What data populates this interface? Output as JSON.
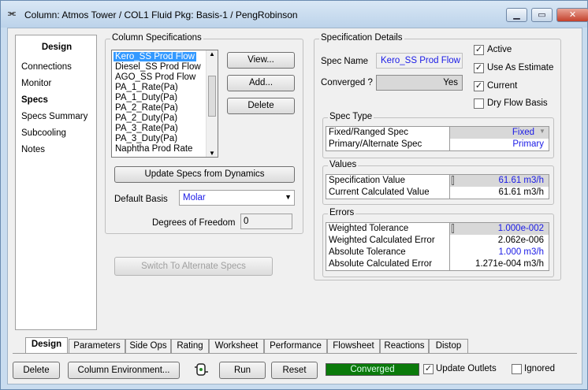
{
  "window": {
    "title": "Column: Atmos Tower / COL1  Fluid Pkg: Basis-1 / PengRobinson",
    "minimize_icon": "minimize-icon",
    "maximize_icon": "maximize-icon",
    "close_icon": "close-icon"
  },
  "nav": {
    "header": "Design",
    "items": [
      "Connections",
      "Monitor",
      "Specs",
      "Specs Summary",
      "Subcooling",
      "Notes"
    ],
    "selected": "Specs"
  },
  "column_specs": {
    "label": "Column Specifications",
    "list": [
      "Kero_SS Prod Flow",
      "Diesel_SS Prod Flow",
      "AGO_SS Prod Flow",
      "PA_1_Rate(Pa)",
      "PA_1_Duty(Pa)",
      "PA_2_Rate(Pa)",
      "PA_2_Duty(Pa)",
      "PA_3_Rate(Pa)",
      "PA_3_Duty(Pa)",
      "Naphtha Prod Rate"
    ],
    "selected": "Kero_SS Prod Flow",
    "view_btn": "View...",
    "add_btn": "Add...",
    "delete_btn": "Delete",
    "update_btn": "Update Specs from Dynamics",
    "default_basis_label": "Default Basis",
    "default_basis_value": "Molar",
    "dof_label": "Degrees of Freedom",
    "dof_value": "0",
    "switch_btn": "Switch To Alternate Specs"
  },
  "spec_details": {
    "label": "Specification Details",
    "spec_name_label": "Spec Name",
    "spec_name_value": "Kero_SS Prod Flow",
    "converged_label": "Converged ?",
    "converged_value": "Yes",
    "checks": [
      {
        "label": "Active",
        "checked": true
      },
      {
        "label": "Use As Estimate",
        "checked": true
      },
      {
        "label": "Current",
        "checked": true
      },
      {
        "label": "Dry Flow Basis",
        "checked": false
      }
    ],
    "spec_type": {
      "label": "Spec Type",
      "rows": [
        {
          "label": "Fixed/Ranged Spec",
          "value": "Fixed"
        },
        {
          "label": "Primary/Alternate Spec",
          "value": "Primary"
        }
      ]
    },
    "values": {
      "label": "Values",
      "rows": [
        {
          "label": "Specification Value",
          "value": "61.61 m3/h"
        },
        {
          "label": "Current Calculated Value",
          "value": "61.61 m3/h"
        }
      ]
    },
    "errors": {
      "label": "Errors",
      "rows": [
        {
          "label": "Weighted Tolerance",
          "value": "1.000e-002"
        },
        {
          "label": "Weighted Calculated Error",
          "value": "2.062e-006"
        },
        {
          "label": "Absolute Tolerance",
          "value": "1.000 m3/h"
        },
        {
          "label": "Absolute Calculated Error",
          "value": "1.271e-004 m3/h"
        }
      ]
    }
  },
  "tabs": [
    "Design",
    "Parameters",
    "Side Ops",
    "Rating",
    "Worksheet",
    "Performance",
    "Flowsheet",
    "Reactions",
    "Distop"
  ],
  "active_tab": "Design",
  "footer": {
    "delete_btn": "Delete",
    "col_env_btn": "Column Environment...",
    "run_btn": "Run",
    "reset_btn": "Reset",
    "status": "Converged",
    "status_color": "#0a7a0a",
    "update_outlets_label": "Update Outlets",
    "update_outlets_checked": true,
    "ignored_label": "Ignored",
    "ignored_checked": false,
    "solver_icon": "solver-icon"
  }
}
